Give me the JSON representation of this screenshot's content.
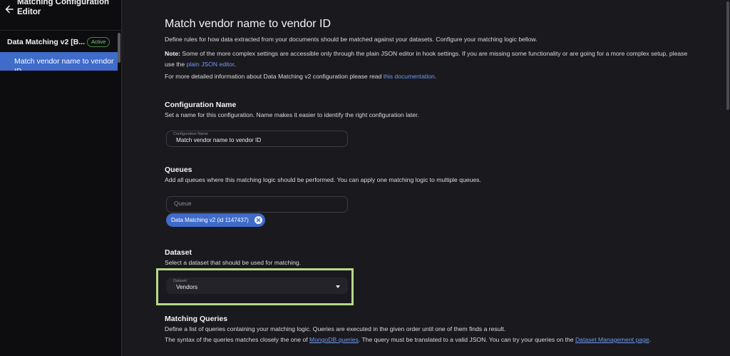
{
  "sidebar": {
    "title": "Matching Configuration Editor",
    "section": {
      "label": "Data Matching v2 [B...",
      "badge": "Active"
    },
    "items": [
      {
        "label": "Match vendor name to vendor ID"
      }
    ]
  },
  "main": {
    "page_title": "Match vendor name to vendor ID",
    "intro": "Define rules for how data extracted from your documents should be matched against your datasets. Configure your matching logic bellow.",
    "note": {
      "label": "Note:",
      "text": " Some of the more complex settings are accessible only through the plain JSON editor in hook settings. If you are missing some functionality or are going for a more complex setup, please use the ",
      "link": "plain JSON editor",
      "end": "."
    },
    "docs": {
      "text": "For more detailed information about Data Matching v2 configuration please read ",
      "link": "this documentation",
      "end": "."
    },
    "config_name": {
      "title": "Configuration Name",
      "description": "Set a name for this configuration. Name makes it easier to identify the right configuration later.",
      "field_label": "Configuration Name",
      "value": "Match vendor name to vendor ID"
    },
    "queues": {
      "title": "Queues",
      "description": "Add all queues where this matching logic should be performed. You can apply one matching logic to multiple queues.",
      "placeholder": "Queue",
      "selected": [
        "Data Matching v2 (id 1147437)"
      ]
    },
    "dataset": {
      "title": "Dataset",
      "description": "Select a dataset that should be used for matching.",
      "field_label": "Dataset",
      "value": "Vendors"
    },
    "matching_queries": {
      "title": "Matching Queries",
      "description": "Define a list of queries containing your matching logic. Queries are executed in the given order until one of them finds a result.",
      "syntax_text": "The syntax of the queries matches closely the one of ",
      "syntax_link": "MongoDB queries",
      "syntax_text2": ". The query must be translated to a valid JSON. You can try your queries on the ",
      "syntax_link2": "Dataset Management page",
      "syntax_end": "."
    }
  },
  "colors": {
    "accent": "#3f6bc9",
    "link": "#6e9bf2",
    "highlight": "#b7d987",
    "active_badge": "#7ccc7c"
  },
  "icons": [
    "back-arrow-icon",
    "close-icon",
    "chevron-down-icon"
  ]
}
